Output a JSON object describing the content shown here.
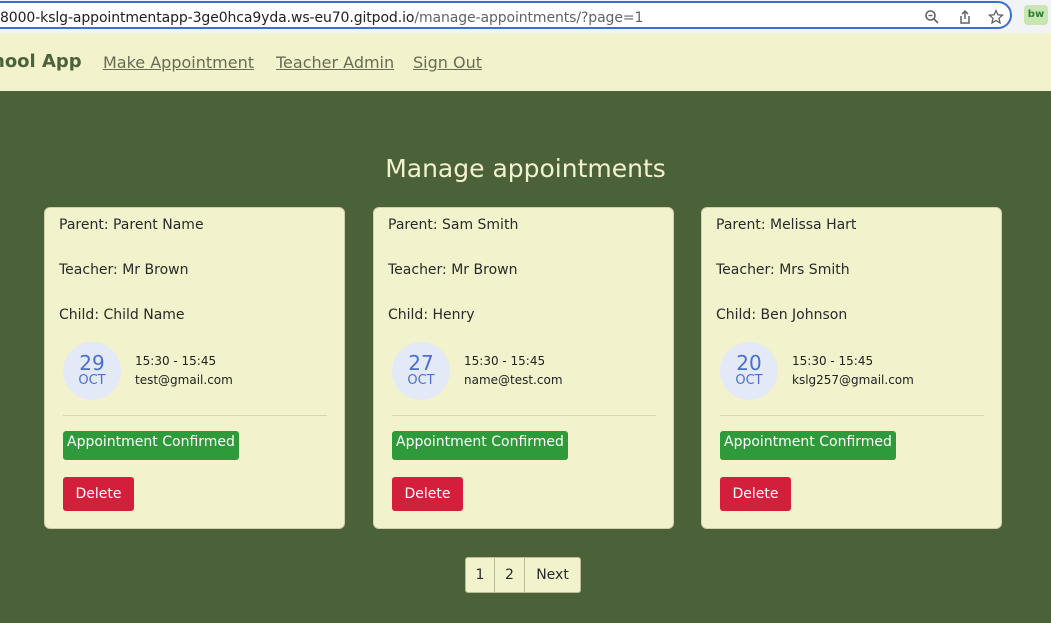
{
  "browser": {
    "url_main": "8000-kslg-appointmentapp-3ge0hca9yda.ws-eu70.gitpod.io",
    "url_path": "/manage-appointments/?page=1",
    "extension_label": "bw",
    "icons": [
      "zoom-icon",
      "share-icon",
      "star-icon"
    ]
  },
  "navbar": {
    "brand": "hool App",
    "links": [
      "Make Appointment",
      "Teacher Admin",
      "Sign Out"
    ]
  },
  "page_title": "Manage appointments",
  "appointments": [
    {
      "parent": "Parent: Parent Name",
      "teacher": "Teacher: Mr Brown",
      "child": "Child: Child Name",
      "day": "29",
      "month": "OCT",
      "time": "15:30 - 15:45",
      "email": "test@gmail.com",
      "status": "Appointment Confirmed",
      "delete_label": "Delete"
    },
    {
      "parent": "Parent: Sam Smith",
      "teacher": "Teacher: Mr Brown",
      "child": "Child: Henry",
      "day": "27",
      "month": "OCT",
      "time": "15:30 - 15:45",
      "email": "name@test.com",
      "status": "Appointment Confirmed",
      "delete_label": "Delete"
    },
    {
      "parent": "Parent: Melissa Hart",
      "teacher": "Teacher: Mrs Smith",
      "child": "Child: Ben Johnson",
      "day": "20",
      "month": "OCT",
      "time": "15:30 - 15:45",
      "email": "kslg257@gmail.com",
      "status": "Appointment Confirmed",
      "delete_label": "Delete"
    }
  ],
  "pagination": [
    "1",
    "2",
    "Next"
  ],
  "colors": {
    "background": "#4b613a",
    "navbar": "#f2f2cc",
    "card": "#f2f2cc",
    "confirmed": "#2f9a3a",
    "delete": "#d41f3c",
    "date_accent": "#4a6fd0"
  }
}
